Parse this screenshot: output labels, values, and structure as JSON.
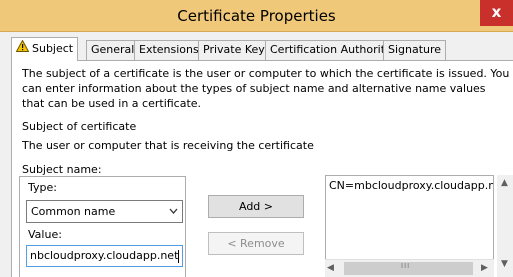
{
  "window": {
    "title": "Certificate Properties",
    "close_glyph": "x"
  },
  "tabs": [
    {
      "label": "Subject",
      "active": true
    },
    {
      "label": "General"
    },
    {
      "label": "Extensions"
    },
    {
      "label": "Private Key"
    },
    {
      "label": "Certification Authority"
    },
    {
      "label": "Signature"
    }
  ],
  "subject": {
    "description": "The subject of a certificate is the user or computer to which the certificate is issued. You can enter information about the types of subject name and alternative name values that can be used in a certificate.",
    "section_title": "Subject of certificate",
    "section_subtitle": "The user or computer that is receiving the certificate",
    "subject_name_label": "Subject name:",
    "type_label": "Type:",
    "type_value": "Common name",
    "value_label": "Value:",
    "value_input": "nbcloudproxy.cloudapp.net",
    "add_button": "Add >",
    "remove_button": "< Remove",
    "list_items": [
      "CN=mbcloudproxy.cloudapp.n"
    ],
    "hscroll_grip": "III"
  },
  "colors": {
    "titlebar": "#f0c87a",
    "close_button": "#c9302c",
    "focus_border": "#569de5"
  },
  "icons": {
    "subject_tab": "warning-icon",
    "type_dropdown": "chevron-down-icon",
    "scroll_left": "arrow-left-icon",
    "scroll_right": "arrow-right-icon",
    "scroll_up": "arrow-up-icon",
    "scroll_down": "arrow-down-icon"
  }
}
